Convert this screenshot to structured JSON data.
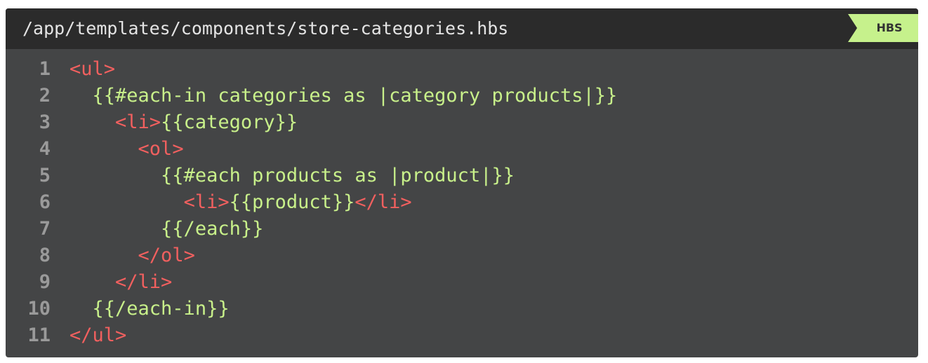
{
  "header": {
    "file_path": "/app/templates/components/store-categories.hbs",
    "language": "HBS"
  },
  "colors": {
    "background": "#444546",
    "header_background": "#2b2b2b",
    "badge": "#c6f18c",
    "tag": "#f2605f",
    "handlebars": "#c8f08a",
    "line_number": "#9a9a9a"
  },
  "lines": [
    {
      "number": "1",
      "indent": "",
      "segments": [
        {
          "kind": "tag",
          "text": "<ul>"
        }
      ]
    },
    {
      "number": "2",
      "indent": "  ",
      "segments": [
        {
          "kind": "hbs",
          "text": "{{#each-in categories as |category products|}}"
        }
      ]
    },
    {
      "number": "3",
      "indent": "    ",
      "segments": [
        {
          "kind": "tag",
          "text": "<li>"
        },
        {
          "kind": "hbs",
          "text": "{{category}}"
        }
      ]
    },
    {
      "number": "4",
      "indent": "      ",
      "segments": [
        {
          "kind": "tag",
          "text": "<ol>"
        }
      ]
    },
    {
      "number": "5",
      "indent": "        ",
      "segments": [
        {
          "kind": "hbs",
          "text": "{{#each products as |product|}}"
        }
      ]
    },
    {
      "number": "6",
      "indent": "          ",
      "segments": [
        {
          "kind": "tag",
          "text": "<li>"
        },
        {
          "kind": "hbs",
          "text": "{{product}}"
        },
        {
          "kind": "tag",
          "text": "</li>"
        }
      ]
    },
    {
      "number": "7",
      "indent": "        ",
      "segments": [
        {
          "kind": "hbs",
          "text": "{{/each}}"
        }
      ]
    },
    {
      "number": "8",
      "indent": "      ",
      "segments": [
        {
          "kind": "tag",
          "text": "</ol>"
        }
      ]
    },
    {
      "number": "9",
      "indent": "    ",
      "segments": [
        {
          "kind": "tag",
          "text": "</li>"
        }
      ]
    },
    {
      "number": "10",
      "indent": "  ",
      "segments": [
        {
          "kind": "hbs",
          "text": "{{/each-in}}"
        }
      ]
    },
    {
      "number": "11",
      "indent": "",
      "segments": [
        {
          "kind": "tag",
          "text": "</ul>"
        }
      ]
    }
  ]
}
